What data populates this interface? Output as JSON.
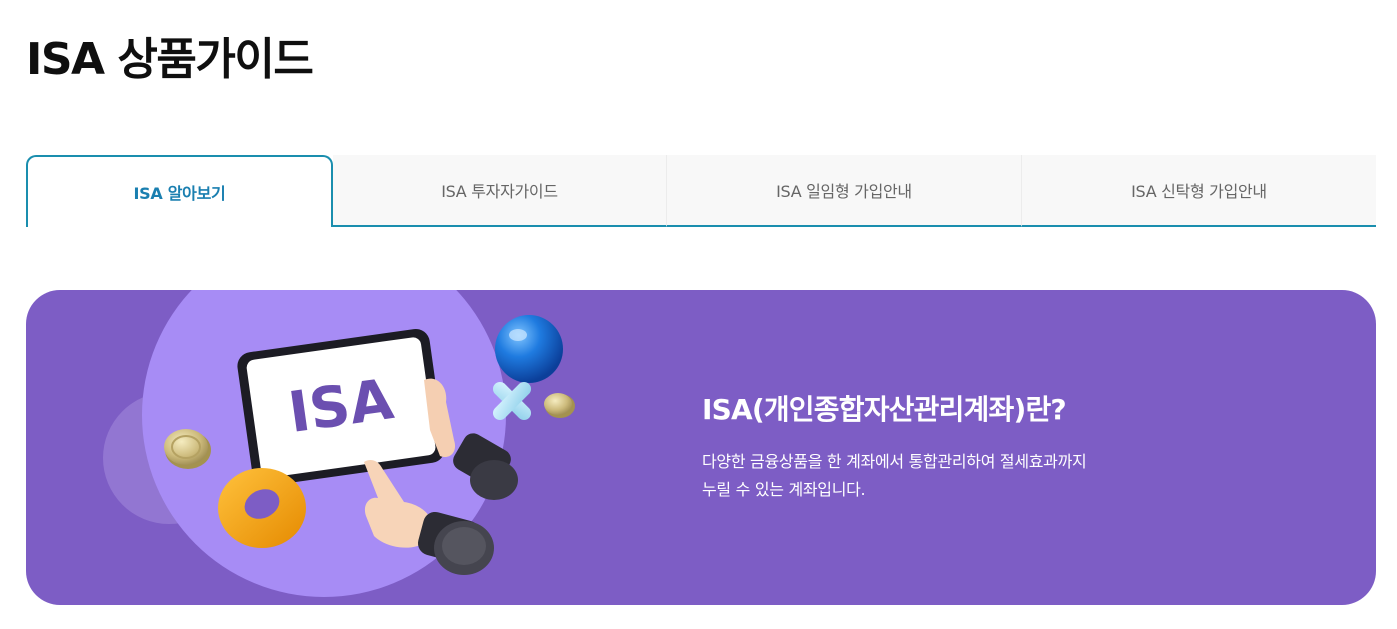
{
  "page": {
    "title": "ISA 상품가이드"
  },
  "tabs": [
    {
      "label": "ISA 알아보기",
      "active": true
    },
    {
      "label": "ISA 투자자가이드",
      "active": false
    },
    {
      "label": "ISA 일임형 가입안내",
      "active": false
    },
    {
      "label": "ISA 신탁형 가입안내",
      "active": false
    }
  ],
  "banner": {
    "illustration_text": "ISA",
    "title": "ISA(개인종합자산관리계좌)란?",
    "desc_line1": "다양한 금융상품을 한 계좌에서 통합관리하여 절세효과까지",
    "desc_line2": "누릴 수 있는 계좌입니다."
  },
  "colors": {
    "accent": "#1a8eae",
    "active_tab_text": "#1a7fb0",
    "banner_bg": "#7d5dc5",
    "illustration_circle": "#a78cf5",
    "tablet_text": "#6b4fb0"
  },
  "icons": [
    "tablet-icon",
    "coin-icon",
    "donut-icon",
    "sphere-icon",
    "cross-icon",
    "hand-icon"
  ]
}
